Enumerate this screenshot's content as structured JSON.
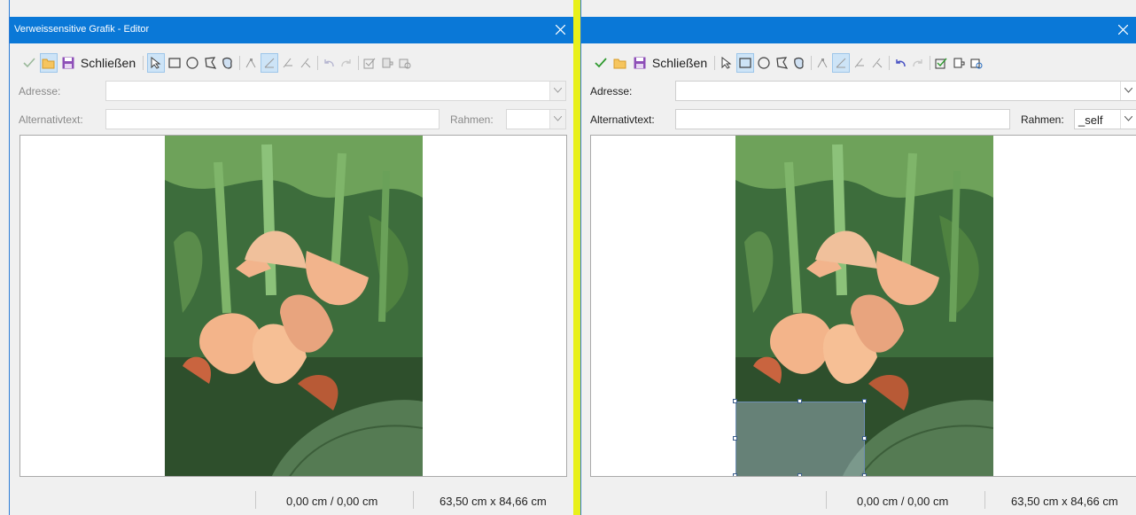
{
  "colors": {
    "titlebar": "#0a78d7",
    "divider": "#e8f01a",
    "selection": "#cde4f7",
    "leaf": "#2f6a2a",
    "flower": "#f2b48c"
  },
  "left": {
    "title": "Verweissensitive Grafik - Editor",
    "toolbar": {
      "close_label": "Schließen"
    },
    "address_label": "Adresse:",
    "address_value": "",
    "alt_label": "Alternativtext:",
    "alt_value": "",
    "frame_label": "Rahmen:",
    "frame_value": "",
    "status": {
      "position": "0,00 cm / 0,00 cm",
      "size": "63,50 cm x 84,66 cm"
    }
  },
  "right": {
    "title": "",
    "toolbar": {
      "close_label": "Schließen"
    },
    "address_label": "Adresse:",
    "address_value": "",
    "alt_label": "Alternativtext:",
    "alt_value": "",
    "frame_label": "Rahmen:",
    "frame_value": "_self",
    "status": {
      "position": "0,00 cm / 0,00 cm",
      "size": "63,50 cm x 84,66 cm"
    }
  },
  "icons": [
    "apply-icon",
    "open-icon",
    "save-icon",
    "select-icon",
    "rectangle-icon",
    "ellipse-icon",
    "polygon-icon",
    "freeform-polygon-icon",
    "edit-points-icon",
    "move-points-icon",
    "insert-points-icon",
    "delete-points-icon",
    "undo-icon",
    "redo-icon",
    "active-icon",
    "macro-icon",
    "properties-icon",
    "close-icon",
    "chevron-down-icon"
  ]
}
